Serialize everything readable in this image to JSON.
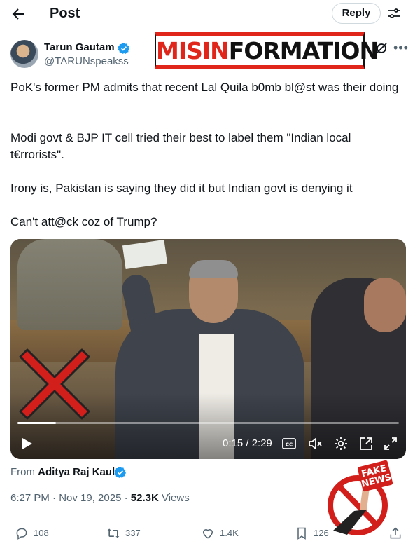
{
  "header": {
    "title": "Post",
    "reply_label": "Reply",
    "back_icon": "back-arrow-icon",
    "filter_icon": "filter-sliders-icon"
  },
  "author": {
    "name": "Tarun Gautam",
    "handle": "@TARUNspeakss",
    "verified": true
  },
  "overlay_stamp": {
    "part1": "MISIN",
    "part2": "FORMATION",
    "color_red": "#e0251b"
  },
  "tweet": {
    "paragraphs": [
      "PoK's former PM admits that recent Lal Quila b0mb bl@st was their doing",
      "Modi govt & BJP IT cell tried their best to label them \"Indian local t€rrorists\".",
      "Irony is, Pakistan is saying they did it but Indian govt is denying it",
      "Can't att@ck coz of Trump?"
    ]
  },
  "video": {
    "time": "0:15 / 2:29",
    "progress": 0.1,
    "controls": [
      "play-icon",
      "captions-icon",
      "mute-icon",
      "settings-icon",
      "picture-in-picture-icon",
      "fullscreen-icon"
    ]
  },
  "source": {
    "prefix": "From",
    "name": "Aditya Raj Kaul",
    "verified": true
  },
  "fake_news_badge": {
    "line1": "FAKE",
    "line2": "NEWS"
  },
  "meta": {
    "timestamp": "6:27 PM · Nov 19, 2025 · ",
    "views_count": "52.3K",
    "views_label": " Views"
  },
  "actions": {
    "replies": "108",
    "reposts": "337",
    "likes": "1.4K",
    "bookmarks": "126"
  },
  "colors": {
    "verified_blue": "#1d9bf0",
    "text_primary": "#0f1419",
    "text_secondary": "#536471"
  }
}
